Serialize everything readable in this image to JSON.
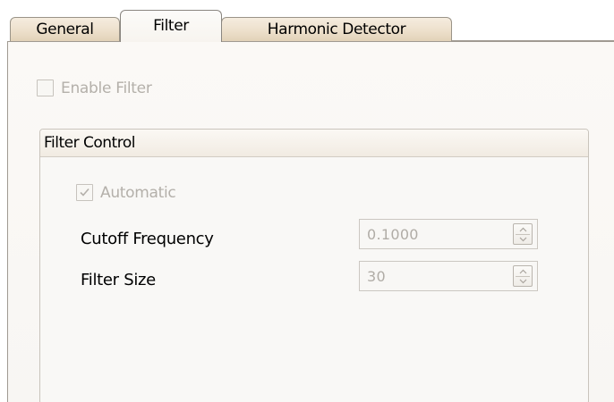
{
  "tabs": [
    {
      "label": "General",
      "active": false
    },
    {
      "label": "Filter",
      "active": true
    },
    {
      "label": "Harmonic Detector",
      "active": false
    }
  ],
  "enable_filter": {
    "label": "Enable Filter",
    "checked": false,
    "enabled": false
  },
  "filter_control": {
    "title": "Filter Control",
    "automatic": {
      "label": "Automatic",
      "checked": true,
      "enabled": false
    },
    "cutoff_frequency": {
      "label": "Cutoff Frequency",
      "value": "0.1000",
      "enabled": false
    },
    "filter_size": {
      "label": "Filter Size",
      "value": "30",
      "enabled": false
    }
  },
  "colors": {
    "tab_inactive": "#ede0cc",
    "page_background": "#f8f6f3",
    "disabled_text": "#b4b0aa",
    "border": "#a09a92"
  }
}
